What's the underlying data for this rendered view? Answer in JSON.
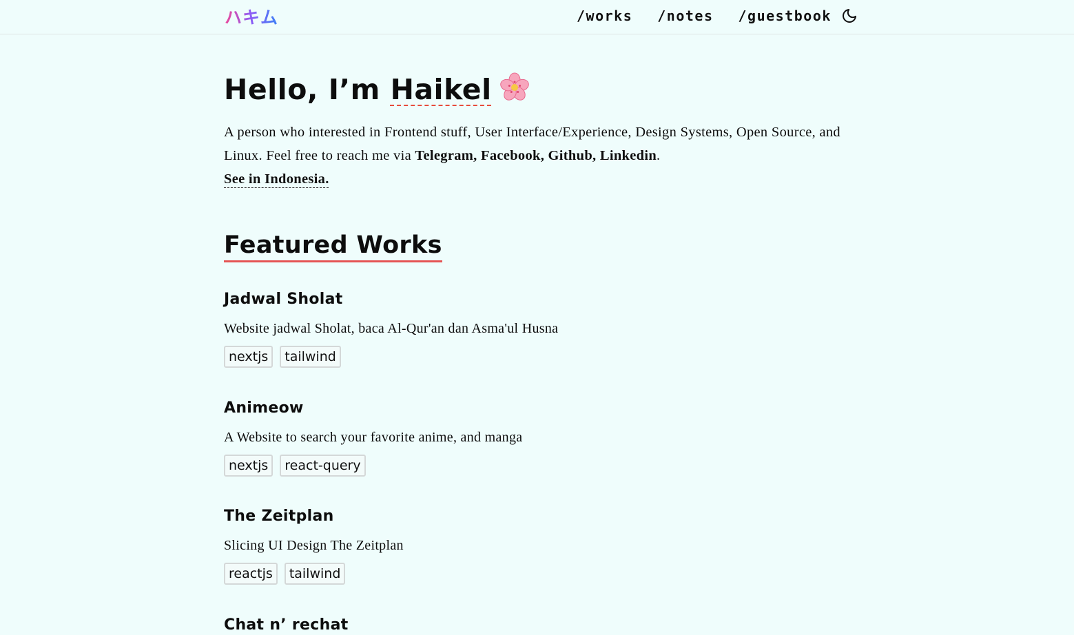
{
  "header": {
    "logo": "ハキム",
    "nav": [
      {
        "label": "/works"
      },
      {
        "label": "/notes"
      },
      {
        "label": "/guestbook"
      }
    ],
    "theme_toggle_icon": "moon-icon"
  },
  "hero": {
    "greeting": "Hello, I’m ",
    "name": "Haikel",
    "emoji_icon": "cherry-blossom-icon",
    "intro_text": "A person who interested in Frontend stuff, User Interface/Experience, Design Systems, Open Source, and Linux. Feel free to reach me via ",
    "socials": "Telegram, Facebook, Github, Linkedin",
    "period": ".",
    "see_indonesia": "See in Indonesia."
  },
  "featured": {
    "title": "Featured Works",
    "works": [
      {
        "title": "Jadwal Sholat",
        "description": "Website jadwal Sholat, baca Al-Qur'an dan Asma'ul Husna",
        "tags": [
          "nextjs",
          "tailwind"
        ]
      },
      {
        "title": "Animeow",
        "description": "A Website to search your favorite anime, and manga",
        "tags": [
          "nextjs",
          "react-query"
        ]
      },
      {
        "title": "The Zeitplan",
        "description": "Slicing UI Design The Zeitplan",
        "tags": [
          "reactjs",
          "tailwind"
        ]
      },
      {
        "title": "Chat n’ rechat",
        "description": "",
        "tags": []
      }
    ]
  },
  "colors": {
    "background": "#effdfc",
    "accent_underline": "#e55353"
  }
}
